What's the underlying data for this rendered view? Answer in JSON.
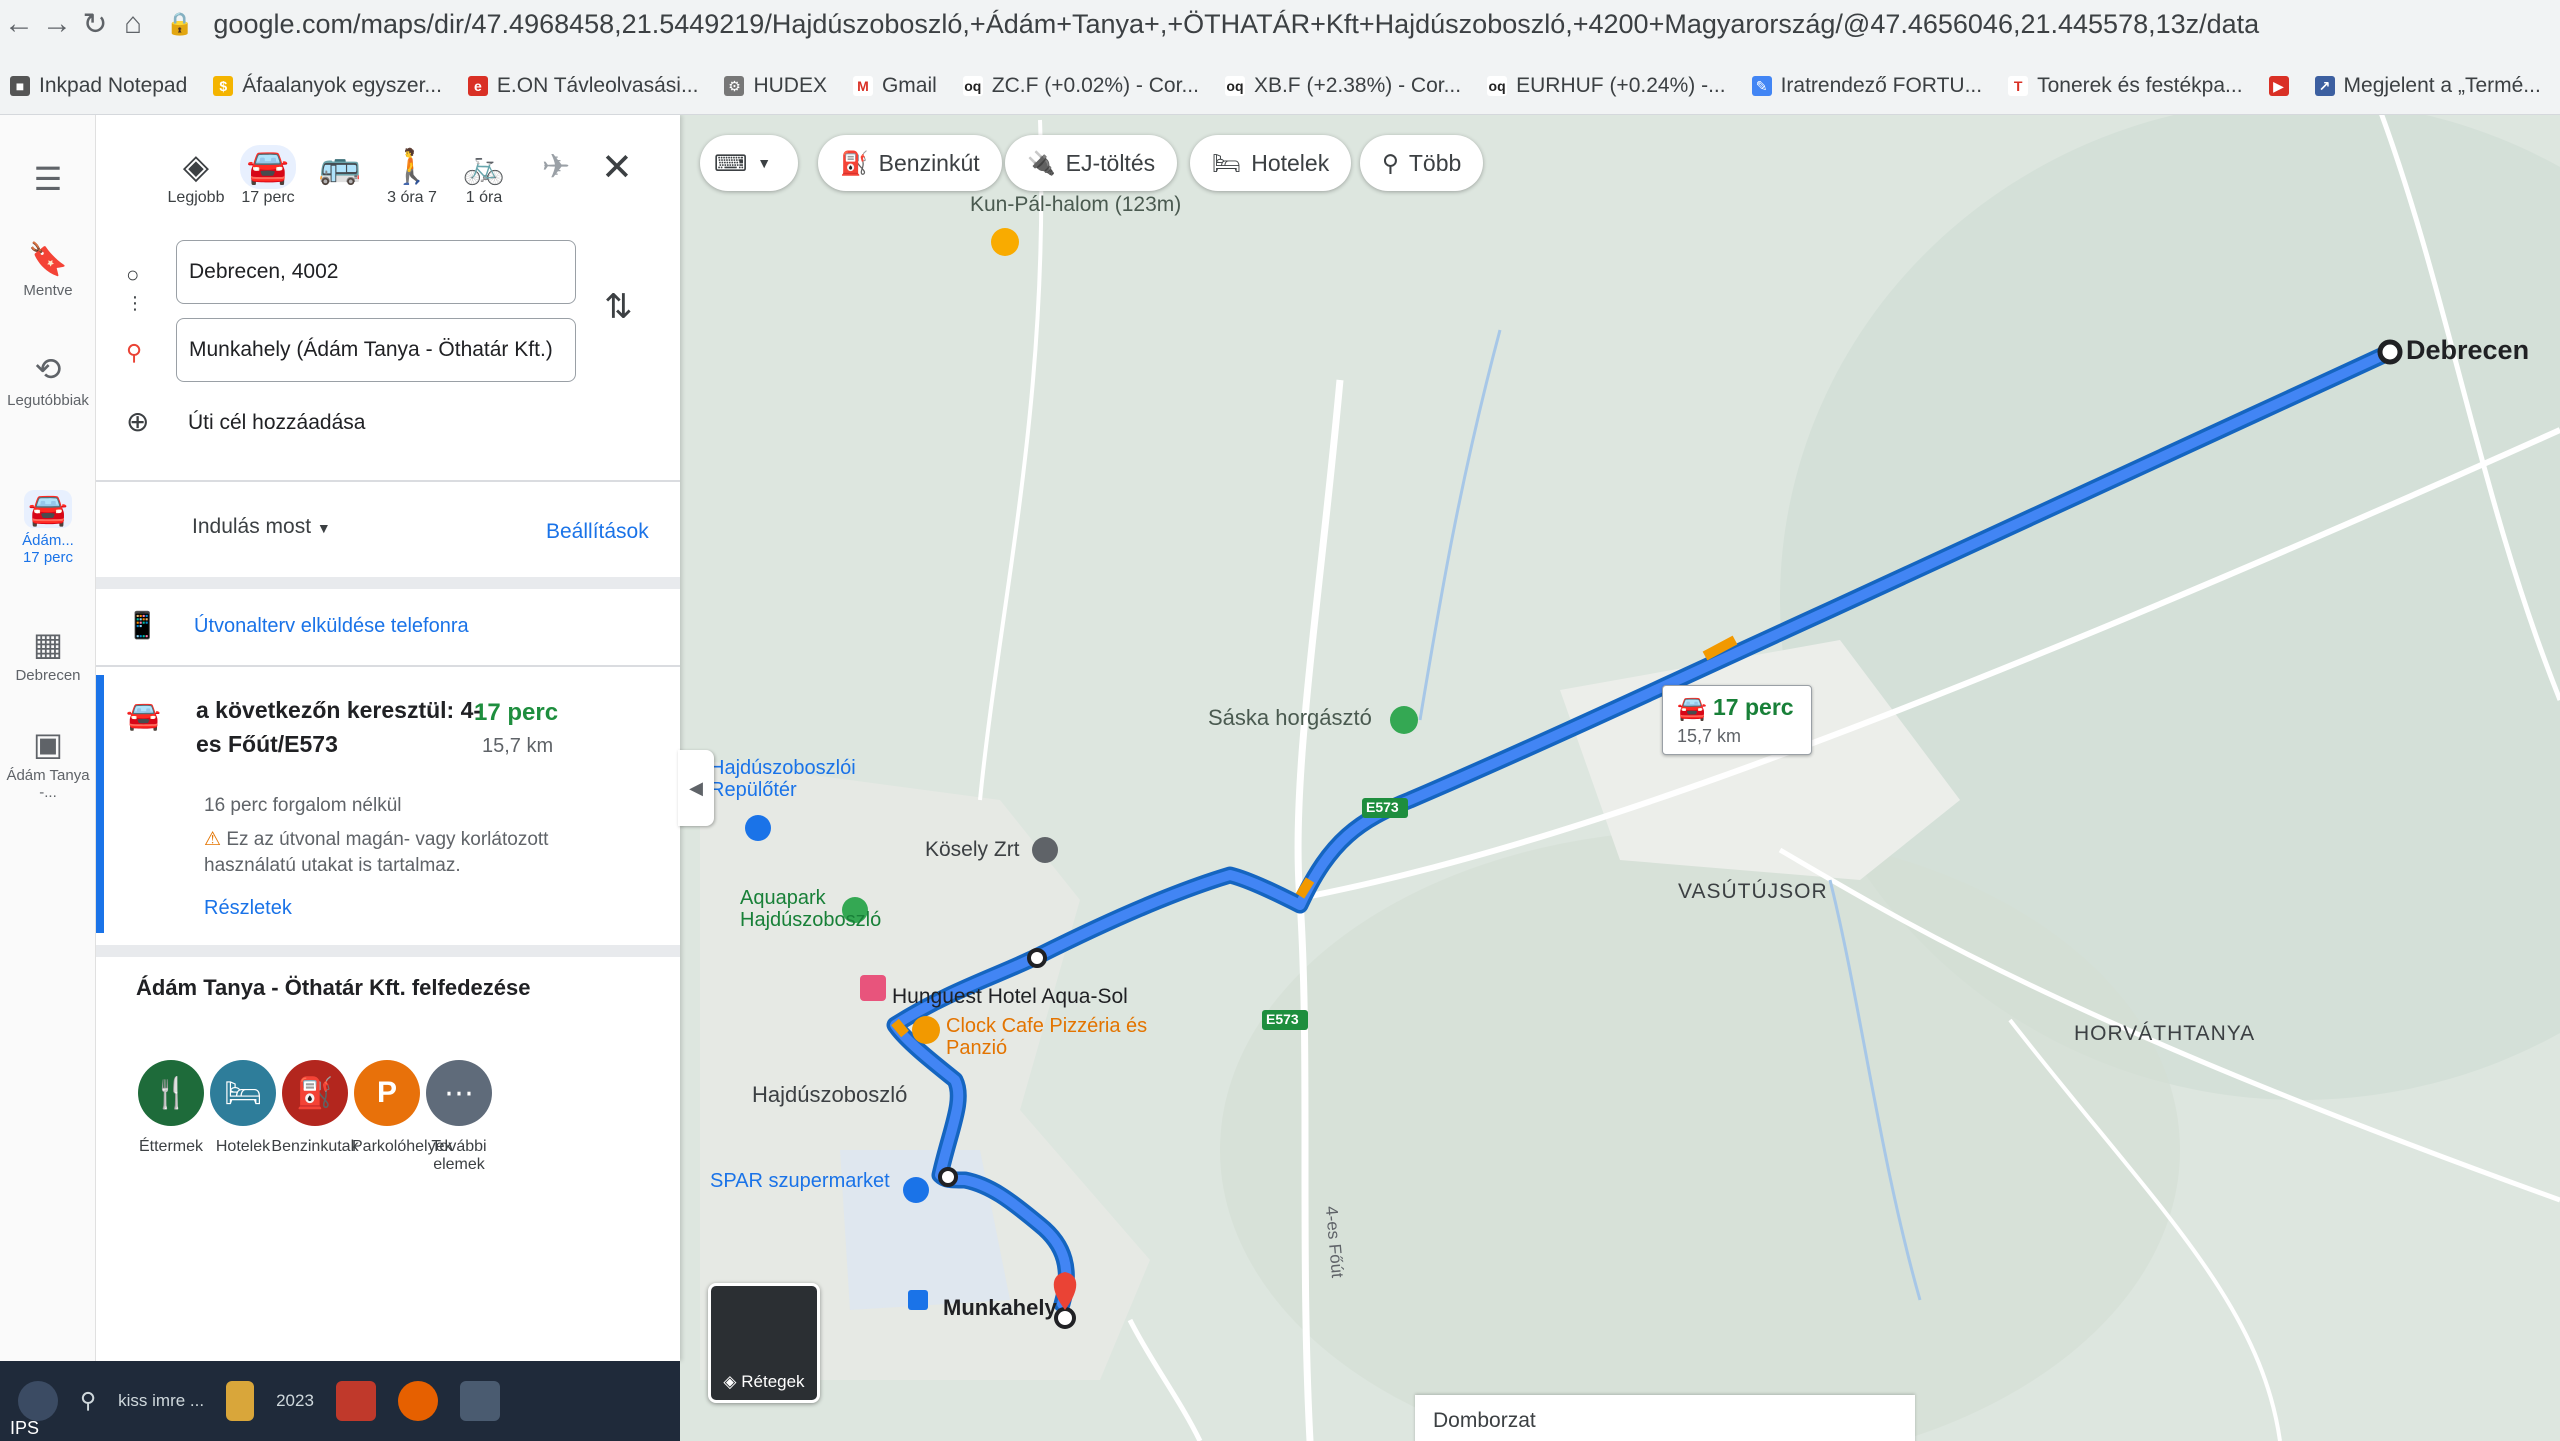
{
  "browser": {
    "url": "google.com/maps/dir/47.4968458,21.5449219/Hajdúszoboszló,+Ádám+Tanya+,+ÖTHATÁR+Kft+Hajdúszoboszló,+4200+Magyarország/@47.4656046,21.445578,13z/data",
    "bookmarks": [
      "Inkpad Notepad",
      "Áfaalanyok egyszer...",
      "E.ON Távleolvasási...",
      "HUDEX",
      "Gmail",
      "ZC.F (+0.02%) - Cor...",
      "XB.F (+2.38%) - Cor...",
      "EURHUF (+0.24%) -...",
      "Iratrendező FORTU...",
      "Tonerek és festékpa...",
      "Megjelent a „Termé..."
    ]
  },
  "rail": {
    "saved": "Mentve",
    "recent": "Legutóbbiak",
    "route1": "Ádám...",
    "route1_time": "17 perc",
    "route2": "Debrecen",
    "route3": "Ádám Tanya -..."
  },
  "panel": {
    "modes": [
      "Legjobb",
      "17 perc",
      "3 óra 7",
      "1 óra"
    ],
    "origin": "Debrecen, 4002",
    "destination": "Munkahely (Ádám Tanya - Öthatár Kft.)",
    "add_stop": "Úti cél hozzáadása",
    "depart": "Indulás most",
    "settings": "Beállítások",
    "send_phone": "Útvonalterv elküldése telefonra",
    "explore_title": "Ádám Tanya - Öthatár Kft. felfedezése",
    "explore": [
      "Éttermek",
      "Hotelek",
      "Benzinkutak",
      "Parkolóhelyek",
      "További elemek"
    ]
  },
  "route": {
    "via": "a következőn keresztül: 4-es Főút/E573",
    "duration": "17 perc",
    "distance": "15,7 km",
    "distance_panel": "15,7 km",
    "no_traffic": "16 perc forgalom nélkül",
    "warning": "Ez az útvonal magán- vagy korlátozott használatú utakat is tartalmaz.",
    "details": "Részletek"
  },
  "chips": [
    "Benzinkút",
    "EJ-töltés",
    "Hotelek",
    "Több"
  ],
  "map": {
    "origin_label": "Debrecen",
    "destination_label": "Munkahely",
    "layers_label": "Rétegek",
    "terrain_label": "Domborzat",
    "labels": {
      "saska": "Sáska horgásztó",
      "kunpal": "Kun-Pál-halom (123m)",
      "kosely": "Kösely Zrt",
      "aquapark": "Aquapark Hajdúszoboszló",
      "repuloter": "Hajdúszoboszlói Repülőtér",
      "hotel": "Hunguest Hotel Aqua-Sol",
      "cafe": "Clock Cafe Pizzéria és Panzió",
      "town": "Hajdúszoboszló",
      "spar": "SPAR szupermarket",
      "vasutujsor": "VASÚTÚJSOR",
      "horvathtanya": "HORVÁTHTANYA",
      "road4": "4-es Főút",
      "e573": "E573"
    }
  },
  "taskbar": {
    "search": "kiss imre ...",
    "folder": "2023",
    "ips": "IPS"
  },
  "colors": {
    "route": "#4285f4",
    "route_outline": "#1565c0",
    "traffic": "#f29900",
    "accent": "#1a73e8",
    "duration_green": "#188038"
  }
}
